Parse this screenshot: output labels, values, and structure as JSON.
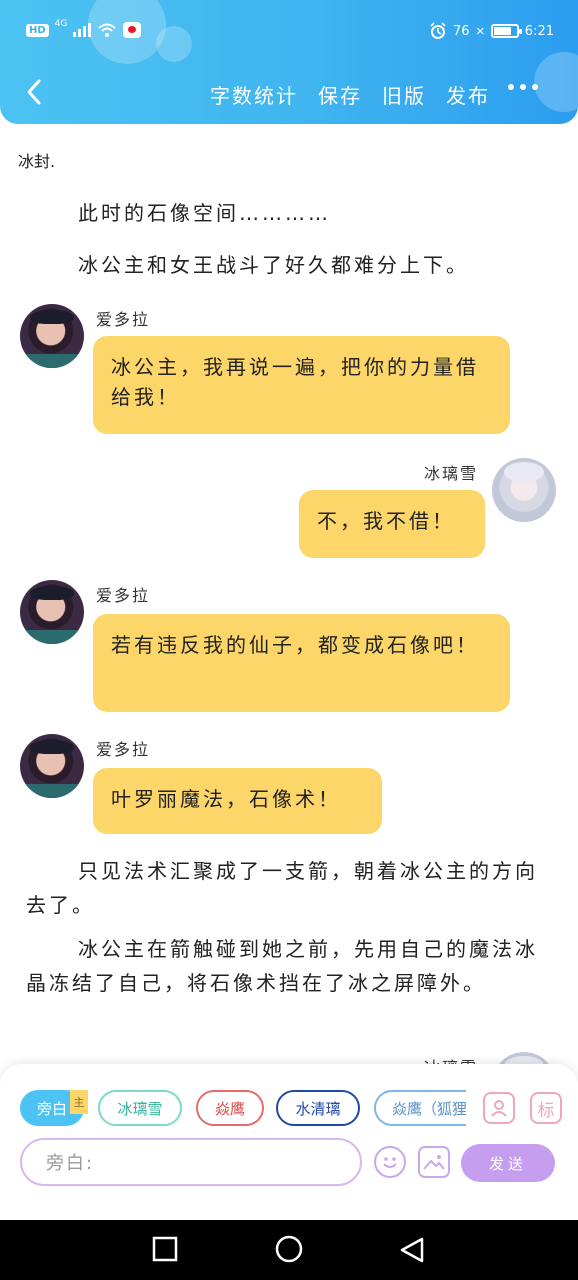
{
  "status_bar": {
    "hd": "HD",
    "network": "4G",
    "battery": "76",
    "battery_level": 0.76,
    "time": "6:21"
  },
  "nav": {
    "actions": [
      "字数统计",
      "保存",
      "旧版",
      "发布"
    ]
  },
  "content": {
    "top_text": "冰封.",
    "narration_1": "此时的石像空间…………",
    "narration_2": "冰公主和女王战斗了好久都难分上下。",
    "messages": [
      {
        "speaker": "爱多拉",
        "text": "冰公主，我再说一遍，把你的力量借给我！"
      },
      {
        "speaker": "冰璃雪",
        "text": "不，我不借！"
      },
      {
        "speaker": "爱多拉",
        "text": "若有违反我的仙子，都变成石像吧！"
      },
      {
        "speaker": "爱多拉",
        "text": "叶罗丽魔法，石像术！"
      }
    ],
    "narration_3": "只见法术汇聚成了一支箭，朝着冰公主的方向去了。",
    "narration_4": "冰公主在箭触碰到她之前，先用自己的魔法冰晶冻结了自己，将石像术挡在了冰之屏障外。",
    "partial_speaker": "冰璃雪"
  },
  "composer": {
    "roles": [
      "旁白",
      "冰璃雪",
      "焱鹰",
      "水清璃",
      "焱鹰（狐狸）"
    ],
    "main_badge": "主",
    "tag_label": "标",
    "input_placeholder": "旁白:",
    "send_label": "发送"
  },
  "colors": {
    "header": "#3fb4ef",
    "bubble": "#fdd66a",
    "send": "#c59ef0"
  }
}
